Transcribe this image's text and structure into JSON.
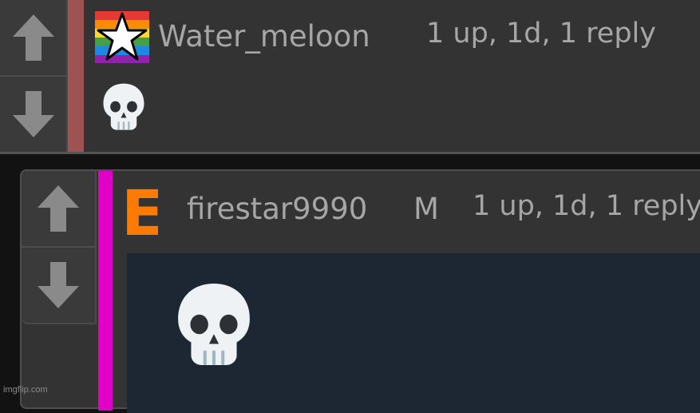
{
  "comments": [
    {
      "username": "Water_meloon",
      "meta": "1 up, 1d, 1 reply",
      "upvote_icon": "up-arrow-icon",
      "downvote_icon": "down-arrow-icon",
      "user_badge": "rainbow-star-flag-icon",
      "body_emoji": "skull-emoji-icon",
      "stripe_color": "#a05252"
    },
    {
      "username": "firestar9990",
      "mod_label": "M",
      "meta": "1 up, 1d, 1 reply",
      "upvote_icon": "up-arrow-icon",
      "downvote_icon": "down-arrow-icon",
      "user_badge": "E",
      "badge_color": "#ff7a00",
      "body_emoji": "skull-emoji-icon",
      "stripe_color": "#e000c8"
    }
  ],
  "watermark": "imgflip.com"
}
